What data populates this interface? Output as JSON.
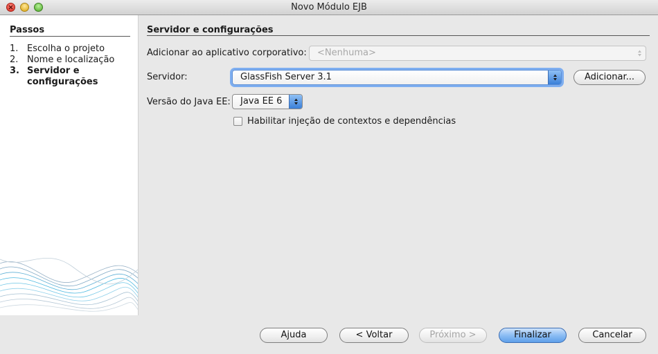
{
  "window": {
    "title": "Novo Módulo EJB"
  },
  "sidebar": {
    "title": "Passos",
    "steps": [
      {
        "num": "1.",
        "label": "Escolha o projeto",
        "current": false
      },
      {
        "num": "2.",
        "label": "Nome e localização",
        "current": false
      },
      {
        "num": "3.",
        "label": "Servidor e configurações",
        "current": true
      }
    ]
  },
  "main": {
    "section_title": "Servidor e configurações",
    "enterprise_app": {
      "label": "Adicionar ao aplicativo corporativo:",
      "value": "<Nenhuma>",
      "enabled": false
    },
    "server": {
      "label": "Servidor:",
      "value": "GlassFish Server 3.1",
      "add_button": "Adicionar..."
    },
    "java_ee": {
      "label": "Versão do Java EE:",
      "value": "Java EE 6"
    },
    "cdi": {
      "label": "Habilitar injeção de contextos e dependências",
      "checked": false
    }
  },
  "footer": {
    "help": "Ajuda",
    "back": "< Voltar",
    "next": "Próximo >",
    "finish": "Finalizar",
    "cancel": "Cancelar"
  },
  "colors": {
    "focus_ring": "#7eaef0",
    "default_button": "#5fa0ea"
  }
}
